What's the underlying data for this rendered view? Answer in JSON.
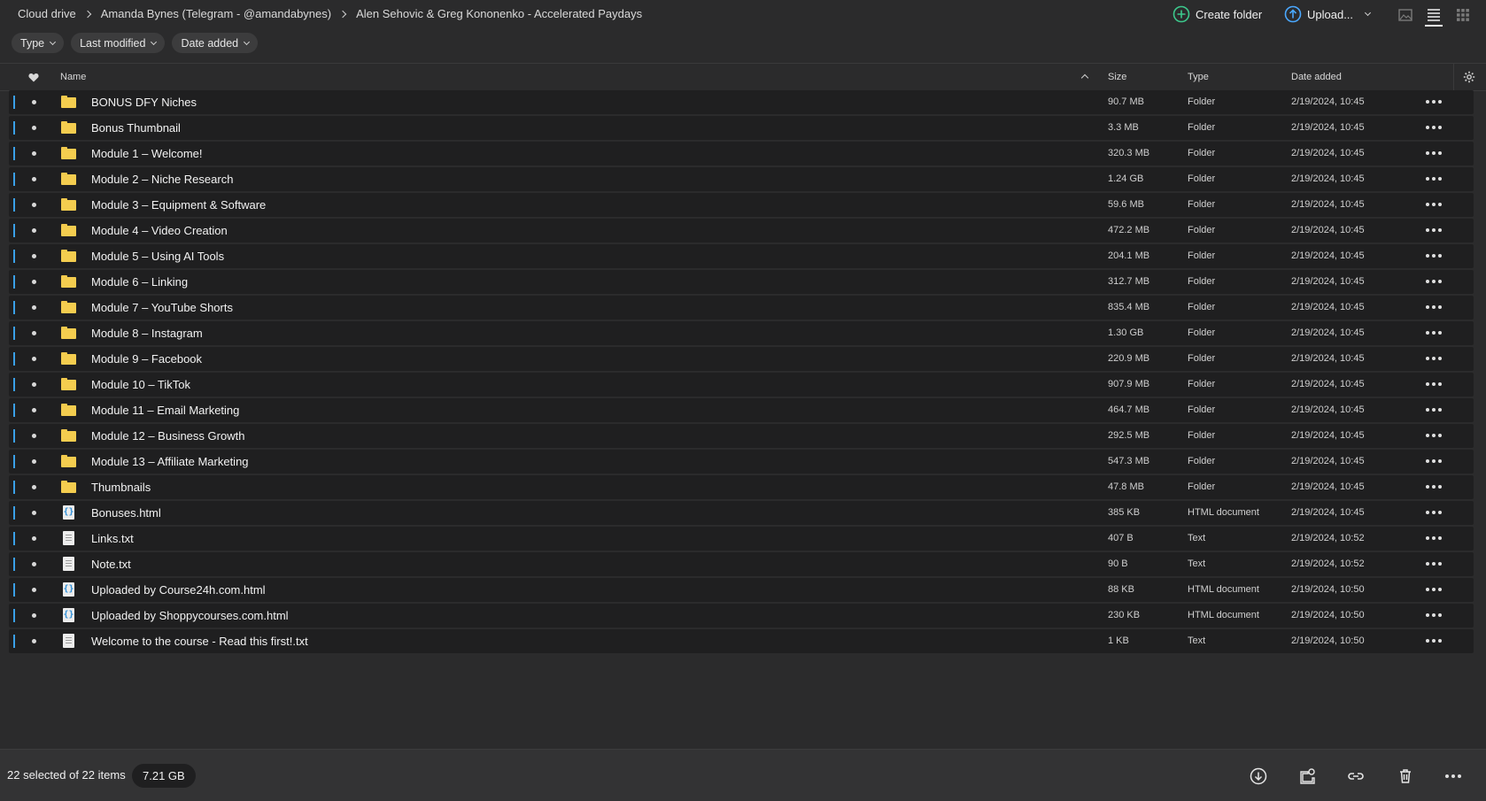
{
  "breadcrumb": [
    "Cloud drive",
    "Amanda Bynes (Telegram - @amandabynes)",
    "Alen Sehovic & Greg Kononenko - Accelerated Paydays"
  ],
  "actions": {
    "create_folder": "Create folder",
    "upload": "Upload..."
  },
  "filters": [
    "Type",
    "Last modified",
    "Date added"
  ],
  "columns": {
    "name": "Name",
    "size": "Size",
    "type": "Type",
    "date_added": "Date added"
  },
  "files": [
    {
      "name": "BONUS DFY Niches",
      "size": "90.7 MB",
      "type": "Folder",
      "date": "2/19/2024, 10:45",
      "icon": "folder-icon"
    },
    {
      "name": "Bonus Thumbnail",
      "size": "3.3 MB",
      "type": "Folder",
      "date": "2/19/2024, 10:45",
      "icon": "folder-icon"
    },
    {
      "name": "Module 1 – Welcome!",
      "size": "320.3 MB",
      "type": "Folder",
      "date": "2/19/2024, 10:45",
      "icon": "folder-icon"
    },
    {
      "name": "Module 2 – Niche Research",
      "size": "1.24 GB",
      "type": "Folder",
      "date": "2/19/2024, 10:45",
      "icon": "folder-icon"
    },
    {
      "name": "Module 3 – Equipment & Software",
      "size": "59.6 MB",
      "type": "Folder",
      "date": "2/19/2024, 10:45",
      "icon": "folder-icon"
    },
    {
      "name": "Module 4 – Video Creation",
      "size": "472.2 MB",
      "type": "Folder",
      "date": "2/19/2024, 10:45",
      "icon": "folder-icon"
    },
    {
      "name": "Module 5 – Using AI Tools",
      "size": "204.1 MB",
      "type": "Folder",
      "date": "2/19/2024, 10:45",
      "icon": "folder-icon"
    },
    {
      "name": "Module 6 – Linking",
      "size": "312.7 MB",
      "type": "Folder",
      "date": "2/19/2024, 10:45",
      "icon": "folder-icon"
    },
    {
      "name": "Module 7 – YouTube Shorts",
      "size": "835.4 MB",
      "type": "Folder",
      "date": "2/19/2024, 10:45",
      "icon": "folder-icon"
    },
    {
      "name": "Module 8 – Instagram",
      "size": "1.30 GB",
      "type": "Folder",
      "date": "2/19/2024, 10:45",
      "icon": "folder-icon"
    },
    {
      "name": "Module 9 – Facebook",
      "size": "220.9 MB",
      "type": "Folder",
      "date": "2/19/2024, 10:45",
      "icon": "folder-icon"
    },
    {
      "name": "Module 10 – TikTok",
      "size": "907.9 MB",
      "type": "Folder",
      "date": "2/19/2024, 10:45",
      "icon": "folder-icon"
    },
    {
      "name": "Module 11 – Email Marketing",
      "size": "464.7 MB",
      "type": "Folder",
      "date": "2/19/2024, 10:45",
      "icon": "folder-icon"
    },
    {
      "name": "Module 12 – Business Growth",
      "size": "292.5 MB",
      "type": "Folder",
      "date": "2/19/2024, 10:45",
      "icon": "folder-icon"
    },
    {
      "name": "Module 13 – Affiliate Marketing",
      "size": "547.3 MB",
      "type": "Folder",
      "date": "2/19/2024, 10:45",
      "icon": "folder-icon"
    },
    {
      "name": "Thumbnails",
      "size": "47.8 MB",
      "type": "Folder",
      "date": "2/19/2024, 10:45",
      "icon": "folder-icon"
    },
    {
      "name": "Bonuses.html",
      "size": "385 KB",
      "type": "HTML document",
      "date": "2/19/2024, 10:45",
      "icon": "html-file-icon"
    },
    {
      "name": "Links.txt",
      "size": "407 B",
      "type": "Text",
      "date": "2/19/2024, 10:52",
      "icon": "text-file-icon"
    },
    {
      "name": "Note.txt",
      "size": "90 B",
      "type": "Text",
      "date": "2/19/2024, 10:52",
      "icon": "text-file-icon"
    },
    {
      "name": "Uploaded by Course24h.com.html",
      "size": "88 KB",
      "type": "HTML document",
      "date": "2/19/2024, 10:50",
      "icon": "html-file-icon"
    },
    {
      "name": "Uploaded by Shoppycourses.com.html",
      "size": "230 KB",
      "type": "HTML document",
      "date": "2/19/2024, 10:50",
      "icon": "html-file-icon"
    },
    {
      "name": "Welcome to the course - Read this first!.txt",
      "size": "1 KB",
      "type": "Text",
      "date": "2/19/2024, 10:50",
      "icon": "text-file-icon"
    }
  ],
  "footer": {
    "selection": "22 selected of 22 items",
    "total_size": "7.21 GB"
  },
  "colors": {
    "background": "#2b2b2c",
    "row": "#1f1f20",
    "folder": "#f4cd4f",
    "accent": "#3aa0e8"
  }
}
